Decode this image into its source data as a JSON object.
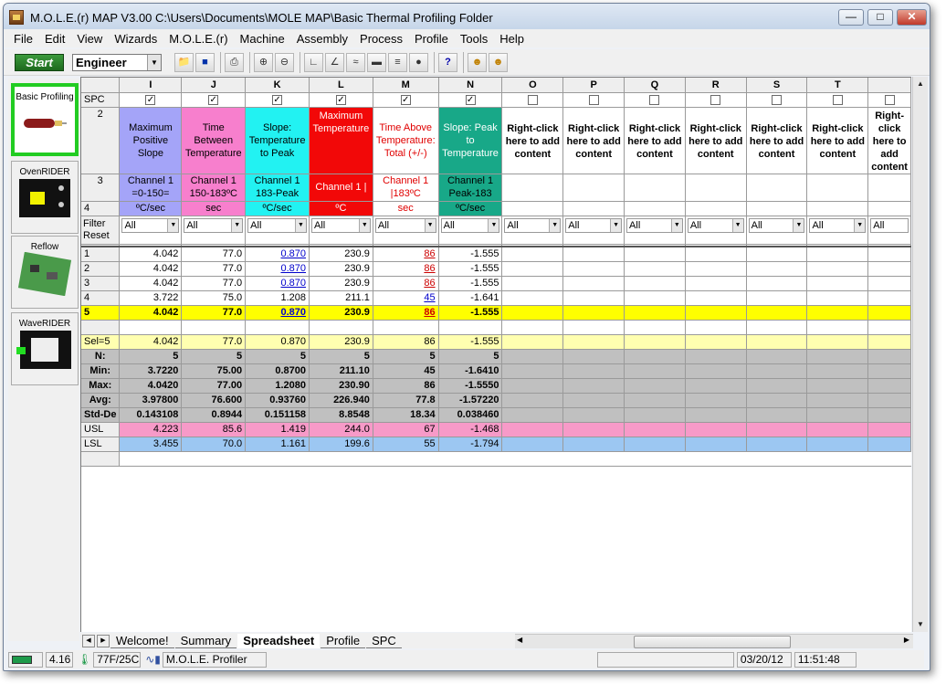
{
  "window": {
    "title": "M.O.L.E.(r) MAP V3.00   C:\\Users\\Documents\\MOLE MAP\\Basic Thermal Profiling Folder"
  },
  "menu": [
    "File",
    "Edit",
    "View",
    "Wizards",
    "M.O.L.E.(r)",
    "Machine",
    "Assembly",
    "Process",
    "Profile",
    "Tools",
    "Help"
  ],
  "toolbar": {
    "start_label": "Start",
    "user_mode": "Engineer"
  },
  "sidebar": {
    "items": [
      "Basic Profiling",
      "OvenRIDER",
      "Reflow",
      "WaveRIDER"
    ]
  },
  "grid": {
    "columns": [
      "I",
      "J",
      "K",
      "L",
      "M",
      "N",
      "O",
      "P",
      "Q",
      "R",
      "S",
      "T",
      ""
    ],
    "row_labels": {
      "spc": "SPC",
      "r2": "2",
      "r3": "3",
      "r4": "4",
      "filter": "Filter Reset",
      "sel": "Sel=5",
      "n": "N:",
      "min": "Min:",
      "max": "Max:",
      "avg": "Avg:",
      "std": "Std-De",
      "usl": "USL",
      "lsl": "LSL"
    },
    "titles": [
      "Maximum Positive Slope",
      "Time Between Temperature",
      "Slope: Temperature to Peak",
      "Maximum Temperature",
      "Time Above Temperature: Total (+/-)",
      "Slope: Peak to Temperature"
    ],
    "empty_title": "Right-click here to add content",
    "channels": [
      "Channel 1 =0-150=",
      "Channel 1 150-183ºC",
      "Channel 1 183-Peak",
      "Channel 1 |",
      "Channel 1 |183ºC",
      "Channel 1 Peak-183"
    ],
    "units": [
      "ºC/sec",
      "sec",
      "ºC/sec",
      "ºC",
      "sec",
      "ºC/sec"
    ],
    "filter_value": "All",
    "colors": {
      "I": "#a4a4f8",
      "J": "#f77fcd",
      "K": "#22f2f2",
      "L": "#f20808",
      "M": "#ffffff",
      "N": "#18a888"
    },
    "rows": [
      {
        "label": "1",
        "values": [
          "4.042",
          "77.0",
          "0.870",
          "230.9",
          "86",
          "-1.555"
        ]
      },
      {
        "label": "2",
        "values": [
          "4.042",
          "77.0",
          "0.870",
          "230.9",
          "86",
          "-1.555"
        ]
      },
      {
        "label": "3",
        "values": [
          "4.042",
          "77.0",
          "0.870",
          "230.9",
          "86",
          "-1.555"
        ]
      },
      {
        "label": "4",
        "values": [
          "3.722",
          "75.0",
          "1.208",
          "211.1",
          "45",
          "-1.641"
        ]
      },
      {
        "label": "5",
        "values": [
          "4.042",
          "77.0",
          "0.870",
          "230.9",
          "86",
          "-1.555"
        ]
      }
    ],
    "sel": [
      "4.042",
      "77.0",
      "0.870",
      "230.9",
      "86",
      "-1.555"
    ],
    "n": [
      "5",
      "5",
      "5",
      "5",
      "5",
      "5"
    ],
    "min": [
      "3.7220",
      "75.00",
      "0.8700",
      "211.10",
      "45",
      "-1.6410"
    ],
    "max": [
      "4.0420",
      "77.00",
      "1.2080",
      "230.90",
      "86",
      "-1.5550"
    ],
    "avg": [
      "3.97800",
      "76.600",
      "0.93760",
      "226.940",
      "77.8",
      "-1.57220"
    ],
    "std": [
      "0.143108",
      "0.8944",
      "0.151158",
      "8.8548",
      "18.34",
      "0.038460"
    ],
    "usl": [
      "4.223",
      "85.6",
      "1.419",
      "244.0",
      "67",
      "-1.468"
    ],
    "lsl": [
      "3.455",
      "70.0",
      "1.161",
      "199.6",
      "55",
      "-1.794"
    ]
  },
  "tabs": [
    "Welcome!",
    "Summary",
    "Spreadsheet",
    "Profile",
    "SPC"
  ],
  "status": {
    "battery": "4.16",
    "temp": "77F/25C",
    "profiler": "M.O.L.E. Profiler",
    "date": "03/20/12",
    "time": "11:51:48"
  }
}
